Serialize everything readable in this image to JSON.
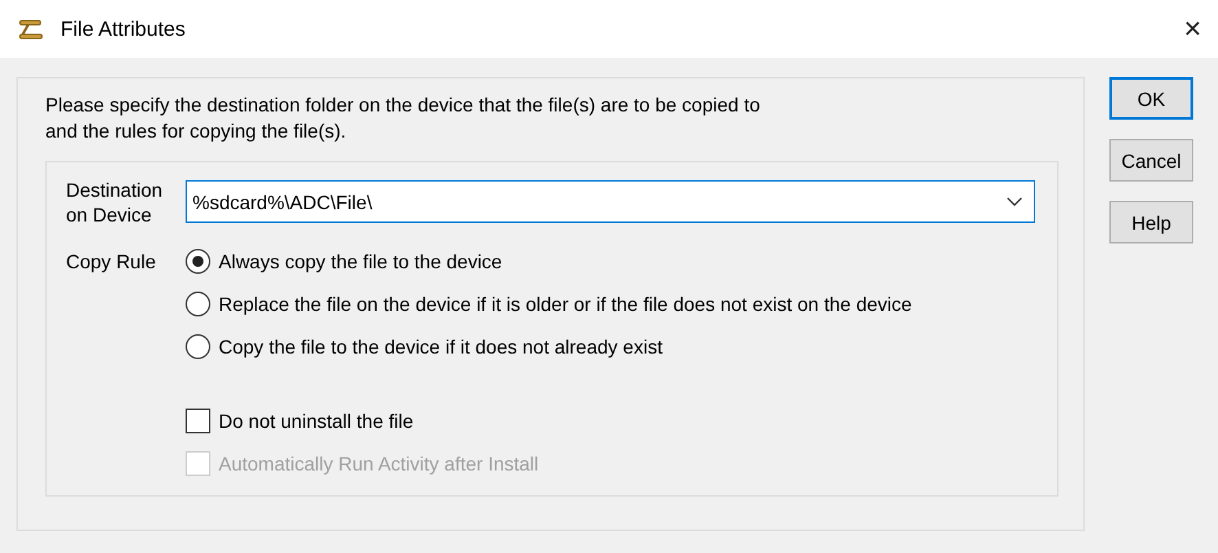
{
  "window": {
    "title": "File Attributes",
    "close": "×"
  },
  "instructions": "Please specify the destination folder on the device that the file(s) are to be copied to\nand the rules for copying the file(s).",
  "destination": {
    "label": "Destination\non Device",
    "value": "%sdcard%\\ADC\\File\\"
  },
  "copy_rule": {
    "label": "Copy Rule",
    "options": [
      {
        "label": "Always copy the file to the device",
        "selected": true
      },
      {
        "label": "Replace the file on the device if it is older or if the file does not exist on the device",
        "selected": false
      },
      {
        "label": "Copy the file to the device if it does not already exist",
        "selected": false
      }
    ]
  },
  "checkboxes": [
    {
      "label": "Do not uninstall the file",
      "checked": false,
      "disabled": false
    },
    {
      "label": "Automatically Run Activity after Install",
      "checked": false,
      "disabled": true
    }
  ],
  "buttons": [
    {
      "label": "OK",
      "default": true
    },
    {
      "label": "Cancel",
      "default": false
    },
    {
      "label": "Help",
      "default": false
    }
  ]
}
